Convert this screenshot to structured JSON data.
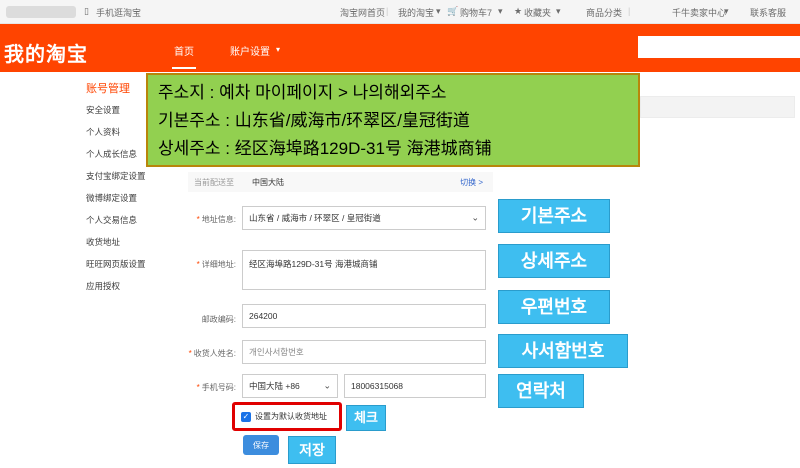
{
  "topbar": {
    "mobile": "手机逛淘宝",
    "home": "淘宝网首页",
    "mytaobao": "我的淘宝",
    "cart": "购物车7",
    "favorites": "收藏夹",
    "categories": "商品分类",
    "seller": "千牛卖家中心",
    "service": "联系客服"
  },
  "header": {
    "logo": "我的淘宝",
    "nav": [
      "首页",
      "账户设置"
    ]
  },
  "sidebar": {
    "title": "账号管理",
    "items": [
      "安全设置",
      "个人资料",
      "个人成长信息",
      "支付宝绑定设置",
      "微博绑定设置",
      "个人交易信息",
      "收货地址",
      "旺旺网页版设置",
      "应用授权"
    ]
  },
  "annotation": {
    "line1": "주소지 : 예차 마이페이지 > 나의해외주소",
    "line2": "기본주소 : 山东省/威海市/环翠区/皇冠街道",
    "line3": "상세주소 : 经区海埠路129D-31号 海港城商铺"
  },
  "form": {
    "deliver_label": "当前配送至",
    "deliver_value": "中国大陆",
    "deliver_link": "切换 >",
    "region_label": "地址信息:",
    "region_value": "山东省 / 威海市 / 环翠区 / 皇冠街道",
    "detail_label": "详细地址:",
    "detail_value": "经区海埠路129D-31号 海港城商铺",
    "zip_label": "邮政编码:",
    "zip_value": "264200",
    "name_label": "收货人姓名:",
    "name_value": "개인사서함번호",
    "phone_label": "手机号码:",
    "phone_country": "中国大陆 +86",
    "phone_value": "18006315068",
    "default_label": "设置为默认收货地址",
    "save_label": "保存"
  },
  "tags": {
    "basic": "기본주소",
    "detail": "상세주소",
    "zip": "우편번호",
    "pobox": "사서함번호",
    "contact": "연락처",
    "check": "체크",
    "save": "저장"
  },
  "colors": {
    "brand": "#ff4400",
    "annotation_bg": "#92d050",
    "tag_bg": "#3ebef0",
    "highlight": "#e00000"
  }
}
